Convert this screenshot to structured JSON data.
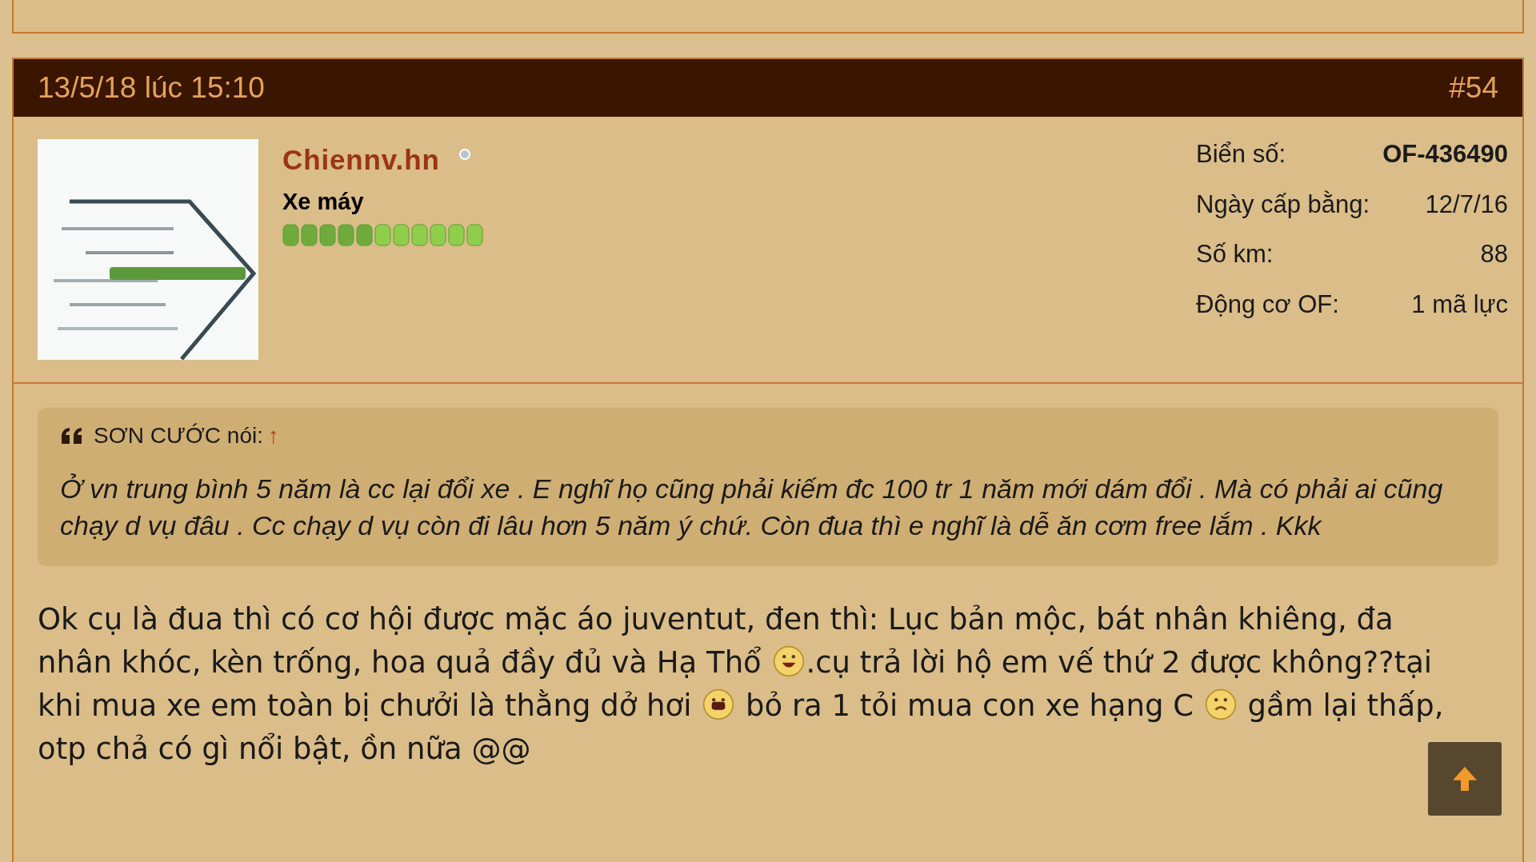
{
  "post": {
    "date": "13/5/18 lúc 15:10",
    "number": "#54",
    "author": {
      "name": "Chiennv.hn",
      "online": false,
      "rank": "Xe máy"
    },
    "stats": [
      {
        "label": "Biển số:",
        "value": "OF-436490",
        "bold": true
      },
      {
        "label": "Ngày cấp bằng:",
        "value": "12/7/16",
        "bold": false
      },
      {
        "label": "Số km:",
        "value": "88",
        "bold": false
      },
      {
        "label": "Động cơ OF:",
        "value": "1 mã lực",
        "bold": false
      }
    ],
    "quote": {
      "author": "SƠN CƯỚC nói:",
      "jump": "↑",
      "text": "Ở vn trung bình 5 năm là cc lại đổi xe . E nghĩ họ cũng phải kiếm đc 100 tr 1 năm mới dám đổi . Mà có phải ai cũng chạy d vụ đâu . Cc chạy d vụ còn đi lâu hơn 5 năm ý chứ. Còn đua thì e nghĩ là dễ ăn cơm free lắm . Kkk"
    },
    "body": [
      {
        "kind": "text",
        "text": "Ok cụ là đua thì có cơ hội được mặc áo juventut, đen thì: Lục bản mộc, bát nhân khiêng, đa nhân khóc, kèn trống, hoa quả đầy đủ và Hạ Thổ "
      },
      {
        "kind": "laugh"
      },
      {
        "kind": "text",
        "text": ".cụ trả lời hộ em vế thứ 2 được không??tại khi mua xe em toàn bị chưởi là thằng dở hơi "
      },
      {
        "kind": "shout"
      },
      {
        "kind": "text",
        "text": " bỏ ra 1 tỏi mua con xe hạng C "
      },
      {
        "kind": "sad"
      },
      {
        "kind": "text",
        "text": " gầm lại thấp, otp chả có gì nổi bật, ồn nữa @@"
      }
    ]
  }
}
